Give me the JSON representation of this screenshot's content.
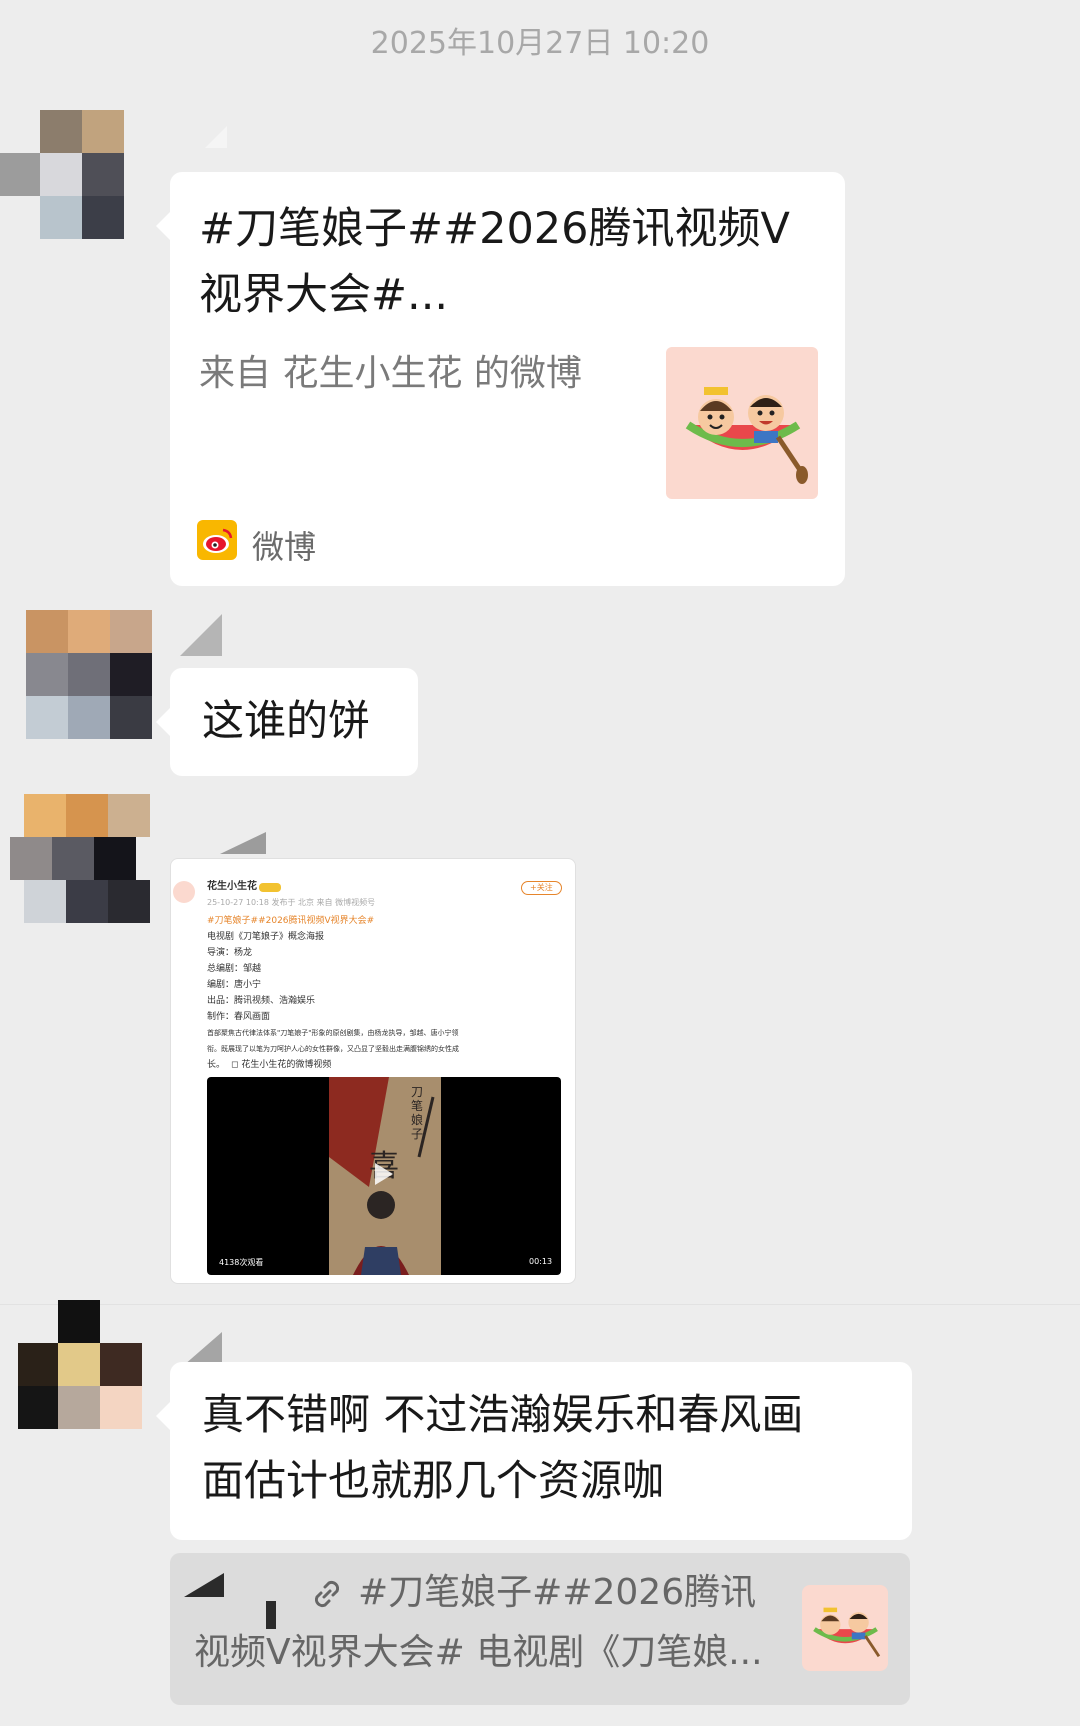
{
  "timestamp": "2025年10月27日 10:20",
  "messages": [
    {
      "type": "link_card",
      "title_line1": "#刀笔娘子##2026腾讯视频V",
      "title_line2": "视界大会#...",
      "subtitle": "来自 花生小生花 的微博",
      "source": "微博",
      "source_icon": "weibo-icon"
    },
    {
      "type": "text",
      "text": "这谁的饼"
    },
    {
      "type": "image",
      "post": {
        "account": "花生小生花",
        "meta": "25-10-27 10:18 发布于 北京 来自 微博视频号",
        "follow": "+关注",
        "hashtag": "#刀笔娘子##2026腾讯视频V视界大会#",
        "lines": [
          "电视剧《刀笔娘子》概念海报",
          "导演：杨龙",
          "总编剧：邹越",
          "编剧：唐小宁",
          "出品：腾讯视频、浩瀚娱乐",
          "制作：春风画面",
          "首部聚焦古代律法体系\"刀笔娘子\"形象的原创剧集，由杨龙执导，邹越、唐小宁领",
          "衔。既展现了以笔为刀呵护人心的女性群像，又凸显了坚毅出走满腹锦绣的女性成",
          "长。"
        ],
        "video_link": "◻ 花生小生花的微博视频",
        "video_views": "4138次观看",
        "video_duration": "00:13",
        "poster_title": "刀笔娘子",
        "poster_char": "喜"
      }
    },
    {
      "type": "text",
      "text_line1": "真不错啊 不过浩瀚娱乐和春风画",
      "text_line2": "面估计也就那几个资源咖",
      "quote_line1": "#刀笔娘子##2026腾讯",
      "quote_line2": "视频V视界大会# 电视剧《刀笔娘...",
      "quote_icon": "link-icon"
    }
  ],
  "colors": {
    "background": "#ededed",
    "bubble": "#ffffff",
    "quote": "#dcdcdc",
    "weibo_red": "#e6162d",
    "weibo_yellow": "#f9b700"
  }
}
